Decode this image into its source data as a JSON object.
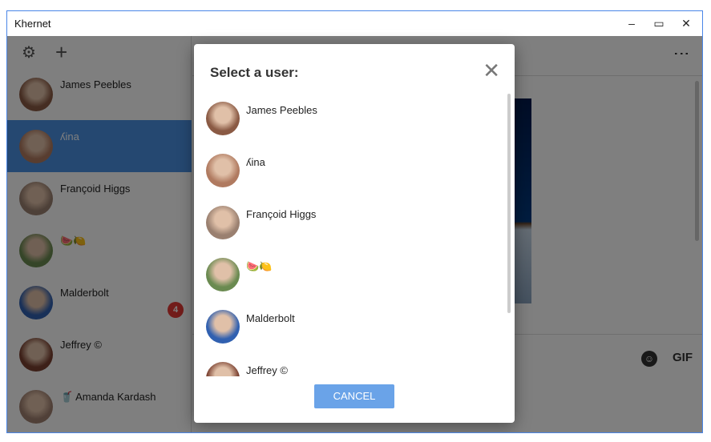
{
  "window": {
    "title": "Khernet",
    "minimize": "‒",
    "maximize": "▭",
    "close": "✕"
  },
  "sidebar": {
    "settings_icon": "⚙",
    "add_icon": "+",
    "badge": "4",
    "contacts": [
      {
        "name": "James Peebles",
        "color": "#8a5a44"
      },
      {
        "name": "ʎina",
        "color": "#b07a60",
        "selected": true
      },
      {
        "name": "Françoid Higgs",
        "color": "#9a8070"
      },
      {
        "name": "🍉🍋",
        "color": "#6a8a50"
      },
      {
        "name": "Malderbolt",
        "color": "#3060b0"
      },
      {
        "name": "Jeffrey ©",
        "color": "#7a4030"
      },
      {
        "name": "🥤 Amanda  Kardash",
        "color": "#a08070"
      }
    ]
  },
  "main": {
    "more_icon": "⋮",
    "emoji_icon": "☺",
    "gif_label": "GIF"
  },
  "dialog": {
    "title": "Select a user:",
    "close_icon": "✕",
    "cancel": "CANCEL",
    "users": [
      {
        "name": "James Peebles",
        "color": "#8a5a44"
      },
      {
        "name": "ʎina",
        "color": "#b07a60"
      },
      {
        "name": "Françoid Higgs",
        "color": "#9a8070"
      },
      {
        "name": "🍉🍋",
        "color": "#6a8a50"
      },
      {
        "name": "Malderbolt",
        "color": "#3060b0"
      },
      {
        "name": "Jeffrey ©",
        "color": "#7a4030"
      }
    ]
  }
}
